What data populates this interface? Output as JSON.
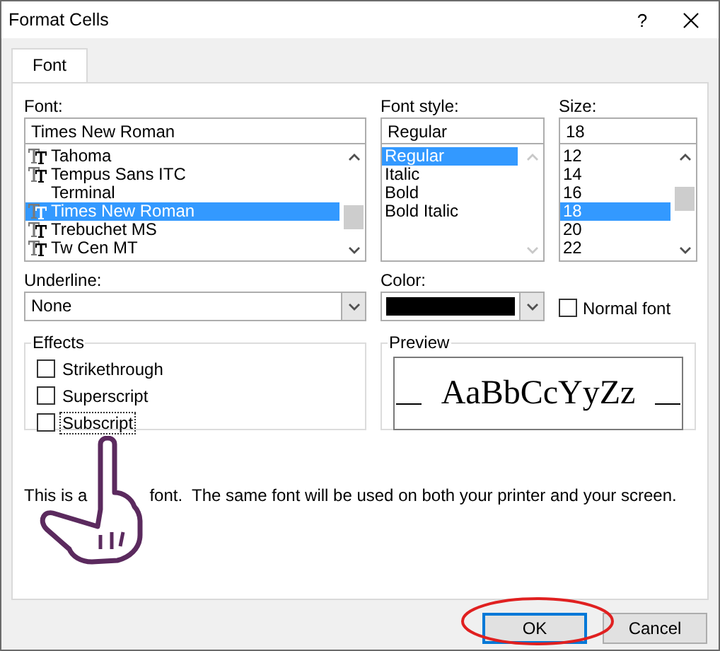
{
  "window": {
    "title": "Format Cells",
    "help": "?"
  },
  "tabs": [
    {
      "label": "Font",
      "selected": true
    }
  ],
  "font": {
    "label": "Font:",
    "value": "Times New Roman",
    "items": [
      {
        "label": "Tahoma",
        "truetype": true,
        "selected": false
      },
      {
        "label": "Tempus Sans ITC",
        "truetype": true,
        "selected": false
      },
      {
        "label": "Terminal",
        "truetype": false,
        "selected": false
      },
      {
        "label": "Times New Roman",
        "truetype": true,
        "selected": true
      },
      {
        "label": "Trebuchet MS",
        "truetype": true,
        "selected": false
      },
      {
        "label": "Tw Cen MT",
        "truetype": true,
        "selected": false
      }
    ]
  },
  "font_style": {
    "label": "Font style:",
    "value": "Regular",
    "items": [
      {
        "label": "Regular",
        "selected": true
      },
      {
        "label": "Italic",
        "selected": false
      },
      {
        "label": "Bold",
        "selected": false
      },
      {
        "label": "Bold Italic",
        "selected": false
      }
    ]
  },
  "size": {
    "label": "Size:",
    "value": "18",
    "items": [
      {
        "label": "12",
        "selected": false
      },
      {
        "label": "14",
        "selected": false
      },
      {
        "label": "16",
        "selected": false
      },
      {
        "label": "18",
        "selected": true
      },
      {
        "label": "20",
        "selected": false
      },
      {
        "label": "22",
        "selected": false
      }
    ]
  },
  "underline": {
    "label": "Underline:",
    "value": "None"
  },
  "color": {
    "label": "Color:",
    "color": "#000000"
  },
  "normal_font": {
    "label": "Normal font",
    "checked": false
  },
  "effects": {
    "title": "Effects",
    "items": [
      {
        "label": "Strikethrough",
        "checked": false,
        "focused": false
      },
      {
        "label": "Superscript",
        "checked": false,
        "focused": false
      },
      {
        "label": "Subscript",
        "checked": false,
        "focused": true
      }
    ]
  },
  "preview": {
    "title": "Preview",
    "sample": "AaBbCcYyZz"
  },
  "info": [
    "This is a",
    "font.  The same font will be used on both your printer and your screen."
  ],
  "buttons": [
    {
      "label": "OK",
      "default": true,
      "highlighted": true
    },
    {
      "label": "Cancel",
      "default": false,
      "highlighted": false
    }
  ]
}
